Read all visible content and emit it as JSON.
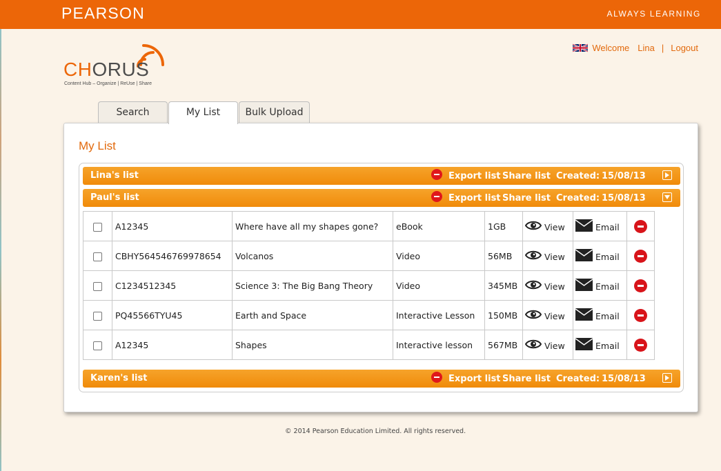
{
  "header": {
    "brand": "PEARSON",
    "tagline": "ALWAYS LEARNING"
  },
  "logo": {
    "ch": "CH",
    "orus": "ORUS",
    "tagline": "Content Hub – Organize | ReUse | Share"
  },
  "user": {
    "welcome": "Welcome",
    "name": "Lina",
    "separator": "|",
    "logout": "Logout"
  },
  "tabs": [
    {
      "label": "Search"
    },
    {
      "label": "My List"
    },
    {
      "label": "Bulk Upload"
    }
  ],
  "page_title": "My List",
  "lists": [
    {
      "name": "Lina's list",
      "export": "Export list",
      "share": "Share list",
      "created_label": "Created:",
      "created": "15/08/13"
    },
    {
      "name": "Paul's list",
      "export": "Export list",
      "share": "Share list",
      "created_label": "Created:",
      "created": "15/08/13"
    },
    {
      "name": "Karen's list",
      "export": "Export list",
      "share": "Share list",
      "created_label": "Created:",
      "created": "15/08/13"
    }
  ],
  "items": [
    {
      "code": "A12345",
      "title": "Where have all my shapes gone?",
      "type": "eBook",
      "size": "1GB",
      "view": "View",
      "email": "Email"
    },
    {
      "code": "CBHY564546769978654",
      "title": "Volcanos",
      "type": "Video",
      "size": "56MB",
      "view": "View",
      "email": "Email"
    },
    {
      "code": "C1234512345",
      "title": "Science 3: The Big Bang Theory",
      "type": "Video",
      "size": "345MB",
      "view": "View",
      "email": "Email"
    },
    {
      "code": "PQ45566TYU45",
      "title": "Earth and Space",
      "type": "Interactive Lesson",
      "size": "150MB",
      "view": "View",
      "email": "Email"
    },
    {
      "code": "A12345",
      "title": "Shapes",
      "type": "Interactive lesson",
      "size": "567MB",
      "view": "View",
      "email": "Email"
    }
  ],
  "footer": "© 2014 Pearson Education Limited. All rights reserved.",
  "colors": {
    "brand": "#ec6608",
    "header_bar": "#f39a1f",
    "delete": "#d8141a"
  }
}
